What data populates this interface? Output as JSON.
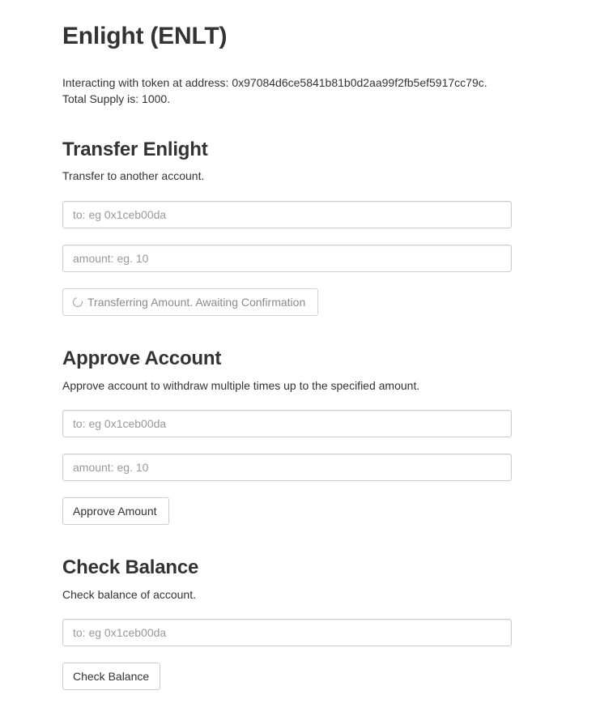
{
  "token": {
    "title": "Enlight (ENLT)",
    "address_line": "Interacting with token at address: 0x97084d6ce5841b81b0d2aa99f2fb5ef5917cc79c.",
    "supply_line": "Total Supply is: 1000."
  },
  "transfer": {
    "heading": "Transfer Enlight",
    "description": "Transfer to another account.",
    "to_placeholder": "to: eg 0x1ceb00da",
    "amount_placeholder": "amount: eg. 10",
    "button_label": "Transferring Amount. Awaiting Confirmation",
    "button_icon": "spinner-icon"
  },
  "approve": {
    "heading": "Approve Account",
    "description": "Approve account to withdraw multiple times up to the specified amount.",
    "to_placeholder": "to: eg 0x1ceb00da",
    "amount_placeholder": "amount: eg. 10",
    "button_label": "Approve Amount"
  },
  "balance": {
    "heading": "Check Balance",
    "description": "Check balance of account.",
    "to_placeholder": "to: eg 0x1ceb00da",
    "button_label": "Check Balance"
  }
}
